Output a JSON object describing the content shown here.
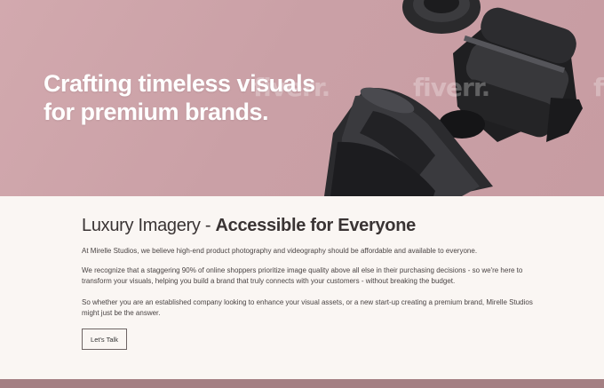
{
  "hero": {
    "title_line1": "Crafting timeless visuals",
    "title_line2": "for premium brands.",
    "watermark": "fiverr.",
    "background_color": "#caa0a6"
  },
  "about": {
    "heading_light": "Luxury Imagery - ",
    "heading_bold": "Accessible for Everyone",
    "paragraph1": "At Mirelle Studios, we believe high-end product photography and videography should be affordable and available to everyone.",
    "paragraph2": "We recognize that a staggering 90% of online shoppers prioritize image quality above all else in their purchasing decisions - so we're here to transform your visuals, helping you build a brand that truly connects with your customers - without breaking the budget.",
    "paragraph3": "So whether you are an established company looking to enhance your visual assets, or a new start-up creating a premium brand, Mirelle Studios might just be the answer.",
    "cta_label": "Let's Talk",
    "background_color": "#faf6f3"
  },
  "footer": {
    "strip_color": "#a47f83"
  }
}
